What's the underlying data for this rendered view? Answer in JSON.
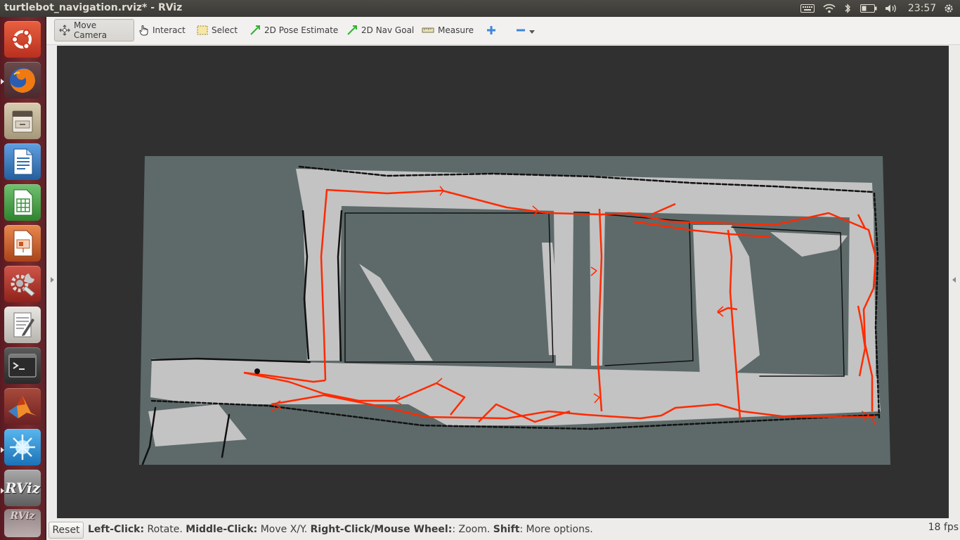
{
  "top_panel": {
    "window_title": "turtlebot_navigation.rviz* - RViz",
    "clock": "23:57",
    "tray_icons": [
      "keyboard-icon",
      "wifi-icon",
      "bluetooth-icon",
      "battery-icon",
      "volume-icon",
      "gear-icon"
    ]
  },
  "launcher": {
    "items": [
      {
        "name": "ubuntu-dash",
        "icon": "ubuntu-logo-icon",
        "color": "#d8452f"
      },
      {
        "name": "firefox",
        "icon": "firefox-icon",
        "color": "#e66000"
      },
      {
        "name": "files",
        "icon": "file-cabinet-icon",
        "color": "#b9a98a"
      },
      {
        "name": "libreoffice-writer",
        "icon": "writer-document-icon",
        "color": "#2f6fb3"
      },
      {
        "name": "libreoffice-calc",
        "icon": "calc-spreadsheet-icon",
        "color": "#38963b"
      },
      {
        "name": "libreoffice-impress",
        "icon": "impress-presentation-icon",
        "color": "#c6571f"
      },
      {
        "name": "system-settings",
        "icon": "settings-wrench-icon",
        "color": "#c53a2f"
      },
      {
        "name": "text-editor",
        "icon": "text-editor-icon",
        "color": "#d9d7d3"
      },
      {
        "name": "terminal",
        "icon": "terminal-icon",
        "color": "#2e2e2e"
      },
      {
        "name": "matlab",
        "icon": "matlab-icon",
        "color": "#e06d1c"
      },
      {
        "name": "unknown-app",
        "icon": "blue-star-icon",
        "color": "#2c8fd6"
      },
      {
        "name": "rviz",
        "icon": "rviz-icon",
        "color": "#8d8d8d"
      }
    ],
    "rviz_label": "RViz"
  },
  "toolbar": {
    "tools": [
      {
        "label": "Move Camera",
        "icon": "move-camera-icon",
        "active": true
      },
      {
        "label": "Interact",
        "icon": "hand-pointer-icon",
        "active": false
      },
      {
        "label": "Select",
        "icon": "select-box-icon",
        "active": false
      },
      {
        "label": "2D Pose Estimate",
        "icon": "pose-arrow-icon",
        "active": false
      },
      {
        "label": "2D Nav Goal",
        "icon": "nav-goal-arrow-icon",
        "active": false
      },
      {
        "label": "Measure",
        "icon": "ruler-icon",
        "active": false
      }
    ],
    "add_tool_icon": "plus-icon",
    "remove_tool_icon": "minus-icon",
    "dropdown_icon": "chevron-down-icon"
  },
  "viewport": {
    "background_color": "#303030",
    "map_unknown_color": "#5e6a6a",
    "map_free_color": "#c2c2c2",
    "map_obstacle_color": "#111111",
    "path_color": "#ff2a00"
  },
  "statusbar": {
    "reset_label": "Reset",
    "hint_left_click_key": "Left-Click:",
    "hint_left_click_action": " Rotate. ",
    "hint_middle_click_key": "Middle-Click:",
    "hint_middle_click_action": " Move X/Y. ",
    "hint_right_click_key": "Right-Click/Mouse Wheel:",
    "hint_right_click_action": ": Zoom. ",
    "hint_shift_key": "Shift",
    "hint_shift_action": ": More options.",
    "fps": "18 fps"
  }
}
